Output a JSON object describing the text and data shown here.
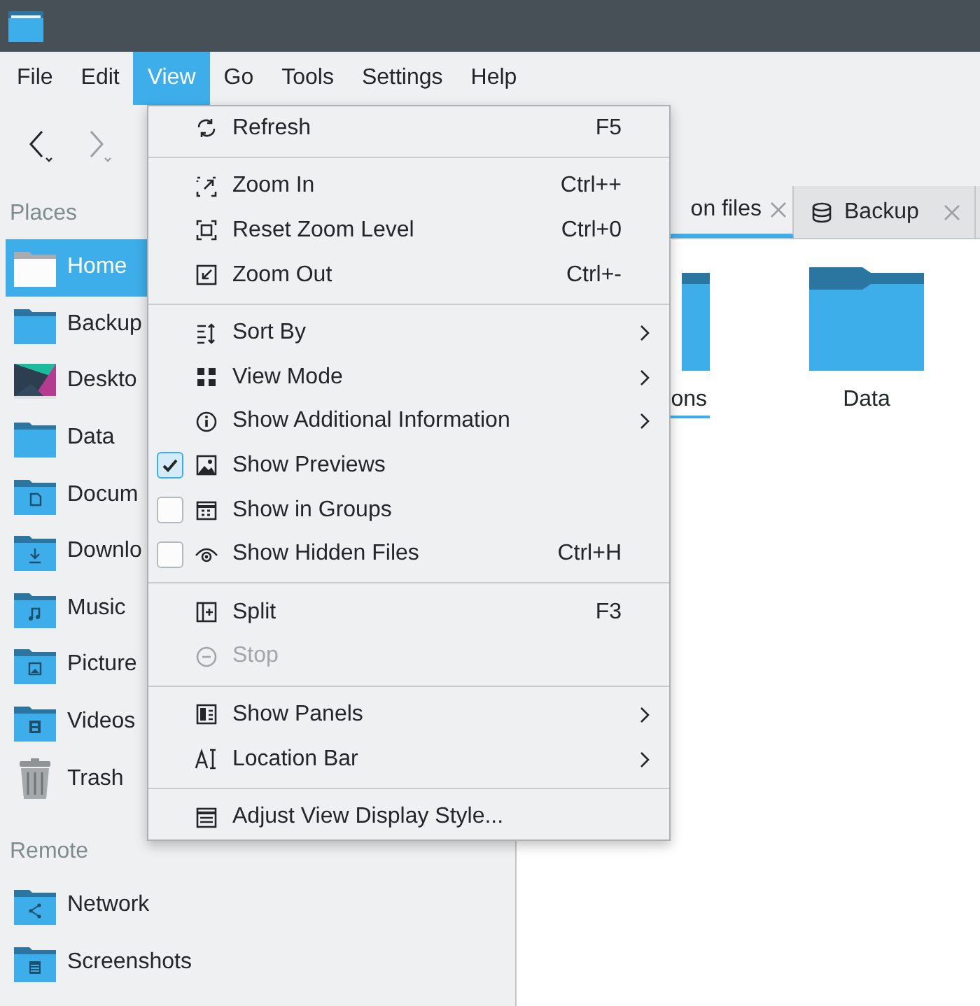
{
  "menubar": [
    {
      "label": "File",
      "selected": false
    },
    {
      "label": "Edit",
      "selected": false
    },
    {
      "label": "View",
      "selected": true
    },
    {
      "label": "Go",
      "selected": false
    },
    {
      "label": "Tools",
      "selected": false
    },
    {
      "label": "Settings",
      "selected": false
    },
    {
      "label": "Help",
      "selected": false
    }
  ],
  "places": {
    "heading": "Places",
    "items": [
      {
        "label": "Home",
        "selected": true
      },
      {
        "label": "Backup",
        "selected": false
      },
      {
        "label": "Deskto",
        "selected": false
      },
      {
        "label": "Data",
        "selected": false
      },
      {
        "label": "Docum",
        "selected": false
      },
      {
        "label": "Downlo",
        "selected": false
      },
      {
        "label": "Music",
        "selected": false
      },
      {
        "label": "Picture",
        "selected": false
      },
      {
        "label": "Videos",
        "selected": false
      },
      {
        "label": "Trash",
        "selected": false
      }
    ]
  },
  "remote": {
    "heading": "Remote",
    "items": [
      {
        "label": "Network",
        "selected": false
      },
      {
        "label": "Screenshots",
        "selected": false
      }
    ]
  },
  "tabs": [
    {
      "label": "on files",
      "selected": true
    },
    {
      "label": "Backup",
      "selected": false
    }
  ],
  "files": [
    {
      "label": "ons",
      "focused": true
    },
    {
      "label": "Data",
      "focused": false
    }
  ],
  "menu": {
    "items": [
      {
        "kind": "action",
        "label": "Refresh",
        "shortcut": "F5",
        "disabled": false
      },
      {
        "kind": "separator"
      },
      {
        "kind": "action",
        "label": "Zoom In",
        "shortcut": "Ctrl++",
        "disabled": false
      },
      {
        "kind": "action",
        "label": "Reset Zoom Level",
        "shortcut": "Ctrl+0",
        "disabled": false
      },
      {
        "kind": "action",
        "label": "Zoom Out",
        "shortcut": "Ctrl+-",
        "disabled": false
      },
      {
        "kind": "separator"
      },
      {
        "kind": "submenu",
        "label": "Sort By",
        "disabled": false
      },
      {
        "kind": "submenu",
        "label": "View Mode",
        "disabled": false
      },
      {
        "kind": "submenu",
        "label": "Show Additional Information",
        "disabled": false
      },
      {
        "kind": "check",
        "label": "Show Previews",
        "checked": true,
        "disabled": false
      },
      {
        "kind": "check",
        "label": "Show in Groups",
        "checked": false,
        "disabled": false
      },
      {
        "kind": "check",
        "label": "Show Hidden Files",
        "shortcut": "Ctrl+H",
        "checked": false,
        "disabled": false
      },
      {
        "kind": "separator"
      },
      {
        "kind": "action",
        "label": "Split",
        "shortcut": "F3",
        "disabled": false
      },
      {
        "kind": "action",
        "label": "Stop",
        "disabled": true
      },
      {
        "kind": "separator"
      },
      {
        "kind": "submenu",
        "label": "Show Panels",
        "disabled": false
      },
      {
        "kind": "submenu",
        "label": "Location Bar",
        "disabled": false
      },
      {
        "kind": "separator"
      },
      {
        "kind": "action",
        "label": "Adjust View Display Style...",
        "disabled": false
      }
    ]
  }
}
